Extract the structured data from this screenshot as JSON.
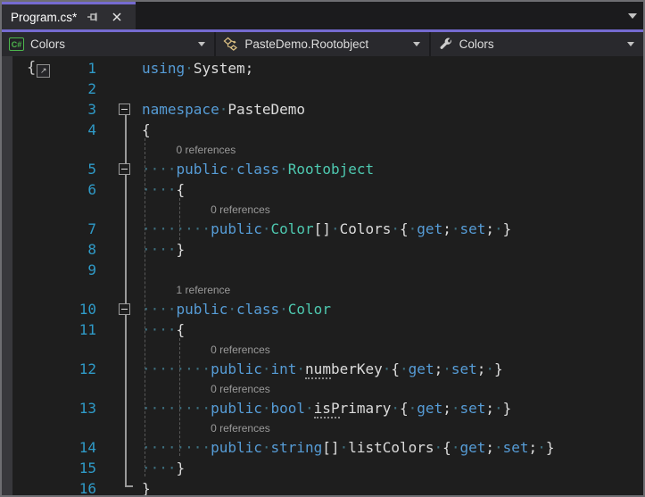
{
  "tab": {
    "title": "Program.cs*",
    "pin_icon": "pin-icon",
    "close_icon": "close-icon"
  },
  "navbar": {
    "project_combo": {
      "icon": "csharp-project-icon",
      "icon_text": "C#",
      "label": "Colors"
    },
    "type_combo": {
      "icon": "type-hierarchy-icon",
      "label": "PasteDemo.Rootobject"
    },
    "member_combo": {
      "icon": "wrench-icon",
      "label": "Colors"
    }
  },
  "colors": {
    "accent_purple": "#756BD1",
    "editor_background": "#1E1E1E",
    "keyword": "#569CD6",
    "type_name": "#4EC9B0",
    "plain_text": "#DCDCDC",
    "whitespace_dot": "#3D7080",
    "line_number": "#2F9BC8",
    "codelens_text": "#9A9A9A",
    "csharp_icon_green": "#4DB64D",
    "type_icon_gold": "#D9BE82"
  },
  "editor": {
    "rows": [
      {
        "n": "1",
        "tokens": [
          [
            "kw",
            "using"
          ],
          [
            "ws",
            "·"
          ],
          [
            "pl",
            "System;"
          ]
        ]
      },
      {
        "n": "2",
        "tokens": []
      },
      {
        "n": "3",
        "fold": true,
        "tokens": [
          [
            "kw",
            "namespace"
          ],
          [
            "ws",
            "·"
          ],
          [
            "pl",
            "PasteDemo"
          ]
        ]
      },
      {
        "n": "4",
        "tokens": [
          [
            "pl",
            "{"
          ]
        ]
      },
      {
        "lens": "0 references",
        "indent": 4
      },
      {
        "n": "5",
        "fold": true,
        "tokens": [
          [
            "ws",
            "····"
          ],
          [
            "kw",
            "public"
          ],
          [
            "ws",
            "·"
          ],
          [
            "kw",
            "class"
          ],
          [
            "ws",
            "·"
          ],
          [
            "ty",
            "Rootobject"
          ]
        ]
      },
      {
        "n": "6",
        "tokens": [
          [
            "ws",
            "····"
          ],
          [
            "pl",
            "{"
          ]
        ]
      },
      {
        "lens": "0 references",
        "indent": 8
      },
      {
        "n": "7",
        "tokens": [
          [
            "ws",
            "········"
          ],
          [
            "kw",
            "public"
          ],
          [
            "ws",
            "·"
          ],
          [
            "ty",
            "Color"
          ],
          [
            "pl",
            "[]"
          ],
          [
            "ws",
            "·"
          ],
          [
            "pl",
            "Colors"
          ],
          [
            "ws",
            "·"
          ],
          [
            "pl",
            "{"
          ],
          [
            "ws",
            "·"
          ],
          [
            "kw",
            "get"
          ],
          [
            "pl",
            ";"
          ],
          [
            "ws",
            "·"
          ],
          [
            "kw",
            "set"
          ],
          [
            "pl",
            ";"
          ],
          [
            "ws",
            "·"
          ],
          [
            "pl",
            "}"
          ]
        ]
      },
      {
        "n": "8",
        "tokens": [
          [
            "ws",
            "····"
          ],
          [
            "pl",
            "}"
          ]
        ]
      },
      {
        "n": "9",
        "tokens": []
      },
      {
        "lens": "1 reference",
        "indent": 4
      },
      {
        "n": "10",
        "fold": true,
        "tokens": [
          [
            "ws",
            "····"
          ],
          [
            "kw",
            "public"
          ],
          [
            "ws",
            "·"
          ],
          [
            "kw",
            "class"
          ],
          [
            "ws",
            "·"
          ],
          [
            "ty",
            "Color"
          ]
        ]
      },
      {
        "n": "11",
        "tokens": [
          [
            "ws",
            "····"
          ],
          [
            "pl",
            "{"
          ]
        ]
      },
      {
        "lens": "0 references",
        "indent": 8
      },
      {
        "n": "12",
        "tokens": [
          [
            "ws",
            "········"
          ],
          [
            "kw",
            "public"
          ],
          [
            "ws",
            "·"
          ],
          [
            "kw",
            "int"
          ],
          [
            "ws",
            "·"
          ],
          [
            "ul",
            "num"
          ],
          [
            "pl",
            "berKey"
          ],
          [
            "ws",
            "·"
          ],
          [
            "pl",
            "{"
          ],
          [
            "ws",
            "·"
          ],
          [
            "kw",
            "get"
          ],
          [
            "pl",
            ";"
          ],
          [
            "ws",
            "·"
          ],
          [
            "kw",
            "set"
          ],
          [
            "pl",
            ";"
          ],
          [
            "ws",
            "·"
          ],
          [
            "pl",
            "}"
          ]
        ]
      },
      {
        "lens": "0 references",
        "indent": 8
      },
      {
        "n": "13",
        "tokens": [
          [
            "ws",
            "········"
          ],
          [
            "kw",
            "public"
          ],
          [
            "ws",
            "·"
          ],
          [
            "kw",
            "bool"
          ],
          [
            "ws",
            "·"
          ],
          [
            "ul",
            "isP"
          ],
          [
            "pl",
            "rimary"
          ],
          [
            "ws",
            "·"
          ],
          [
            "pl",
            "{"
          ],
          [
            "ws",
            "·"
          ],
          [
            "kw",
            "get"
          ],
          [
            "pl",
            ";"
          ],
          [
            "ws",
            "·"
          ],
          [
            "kw",
            "set"
          ],
          [
            "pl",
            ";"
          ],
          [
            "ws",
            "·"
          ],
          [
            "pl",
            "}"
          ]
        ]
      },
      {
        "lens": "0 references",
        "indent": 8
      },
      {
        "n": "14",
        "tokens": [
          [
            "ws",
            "········"
          ],
          [
            "kw",
            "public"
          ],
          [
            "ws",
            "·"
          ],
          [
            "kw",
            "string"
          ],
          [
            "pl",
            "[]"
          ],
          [
            "ws",
            "·"
          ],
          [
            "pl",
            "listColors"
          ],
          [
            "ws",
            "·"
          ],
          [
            "pl",
            "{"
          ],
          [
            "ws",
            "·"
          ],
          [
            "kw",
            "get"
          ],
          [
            "pl",
            ";"
          ],
          [
            "ws",
            "·"
          ],
          [
            "kw",
            "set"
          ],
          [
            "pl",
            ";"
          ],
          [
            "ws",
            "·"
          ],
          [
            "pl",
            "}"
          ]
        ]
      },
      {
        "n": "15",
        "tokens": [
          [
            "ws",
            "····"
          ],
          [
            "pl",
            "}"
          ]
        ]
      },
      {
        "n": "16",
        "tokens": [
          [
            "pl",
            "}"
          ]
        ]
      }
    ]
  }
}
